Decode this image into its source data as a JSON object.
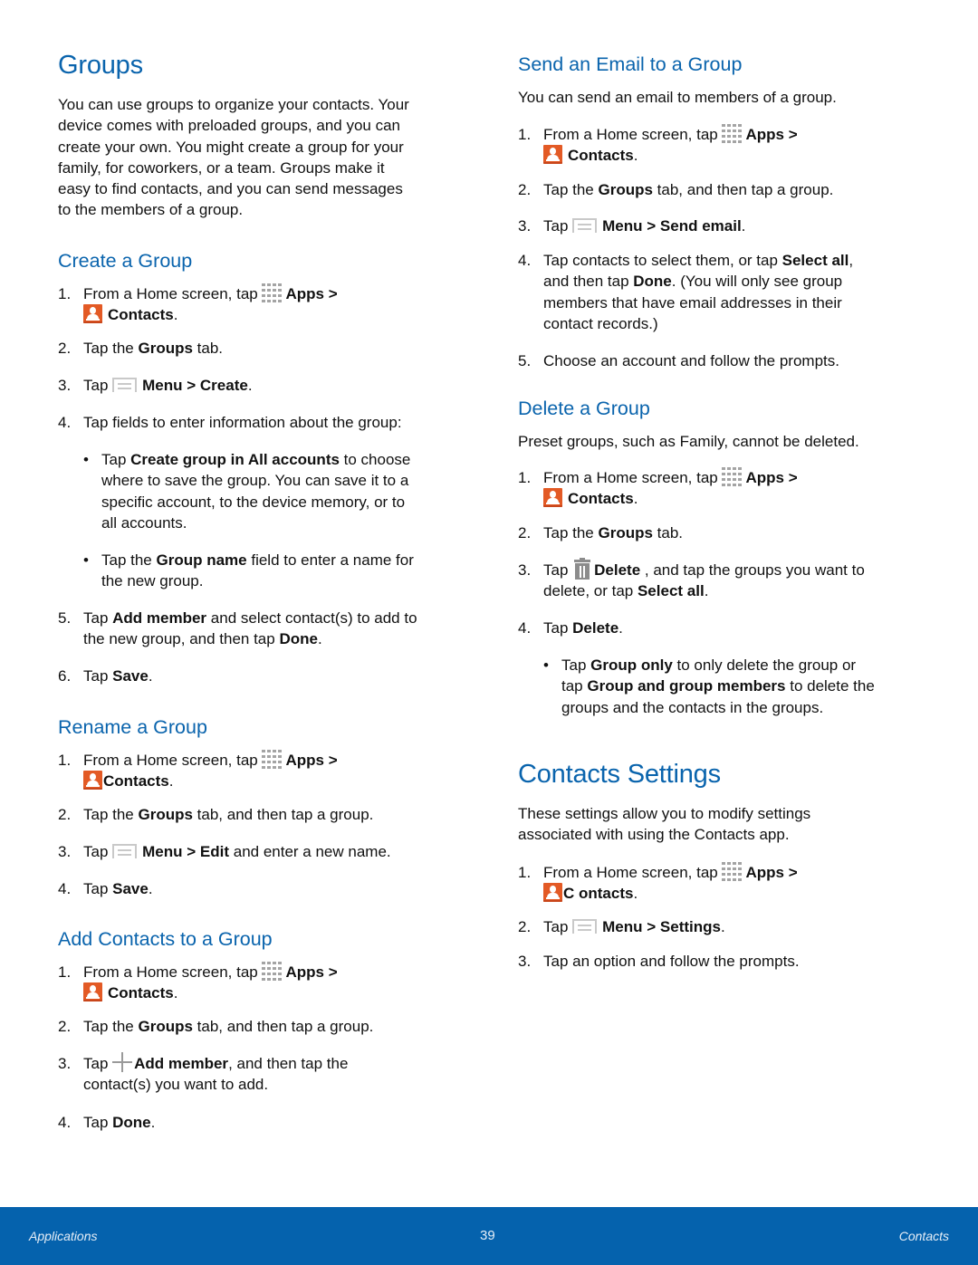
{
  "page": {
    "number": "39",
    "footer_left": "Applications",
    "footer_right": "Contacts",
    "accent_color": "#0a64ad",
    "footer_color": "#0562ad"
  },
  "groups": {
    "title": "Groups",
    "intro_lines": [
      "You can use groups to organize your contacts. Your",
      "device comes with preloaded groups, and you can",
      "create your own. You might create a group for your",
      "family, for coworkers, or a team. Groups make it",
      "easy to find contacts, and you can send messages",
      "to the members of a group."
    ]
  },
  "create_group": {
    "title": "Create a Group",
    "steps": {
      "s1": {
        "num": "1.",
        "pre": "From a Home screen, tap ",
        "apps": "Apps",
        "gt": " >",
        "contacts": "Contacts",
        "end": "."
      },
      "s2": {
        "num": "2.",
        "pre": "Tap the ",
        "b1": "Groups",
        "post": " tab."
      },
      "s3": {
        "num": "3.",
        "pre": "Tap ",
        "b1": "Menu",
        "mid": " > ",
        "b2": "Create",
        "end": "."
      },
      "s4": {
        "num": "4.",
        "text": "Tap fields to enter information about the group:"
      },
      "bullet1": {
        "dot": "•",
        "pre": "Tap ",
        "b1": "Create group in All accounts",
        "post": " to choose",
        "lines": [
          "where to save the group. You can save it to a",
          "specific account, to the device memory, or to",
          "all accounts."
        ]
      },
      "bullet2": {
        "dot": "•",
        "pre": "Tap the ",
        "b1": "Group name",
        "post": " field to enter a name for",
        "line2": "the new group."
      },
      "s5": {
        "num": "5.",
        "pre": "Tap ",
        "b1": "Add member",
        "post": " and select contact(s) to add to",
        "line2_pre": "the new group, and then tap ",
        "line2_b": "Done",
        "line2_end": "."
      },
      "s6": {
        "num": "6.",
        "pre": "Tap ",
        "b1": "Save",
        "end": "."
      }
    }
  },
  "rename_group": {
    "title": "Rename a Group",
    "steps": {
      "s1": {
        "num": "1.",
        "pre": "From a Home screen, tap ",
        "apps": "Apps",
        "gt": " >",
        "contacts": "Contacts",
        "end": "."
      },
      "s2": {
        "num": "2.",
        "pre": "Tap the ",
        "b1": "Groups",
        "post": " tab, and then tap a group."
      },
      "s3": {
        "num": "3.",
        "pre": "Tap ",
        "b1": "Menu",
        "mid": " > ",
        "b2": "Edit",
        "post": " and enter a new name."
      },
      "s4": {
        "num": "4.",
        "pre": "Tap ",
        "b1": "Save",
        "end": "."
      }
    }
  },
  "add_contacts": {
    "title": "Add Contacts to a Group",
    "steps": {
      "s1": {
        "num": "1.",
        "pre": "From a Home screen, tap ",
        "apps": "Apps",
        "gt": " >",
        "contacts": "Contacts",
        "end": "."
      },
      "s2": {
        "num": "2.",
        "pre": "Tap the ",
        "b1": "Groups",
        "post": " tab, and then tap a group."
      },
      "s3": {
        "num": "3.",
        "pre": "Tap ",
        "b1": "Add member",
        "post": ", and then tap the",
        "line2": "contact(s) you want to add."
      },
      "s4": {
        "num": "4.",
        "pre": "Tap ",
        "b1": "Done",
        "end": "."
      }
    }
  },
  "send_email": {
    "title": "Send an Email to a Group",
    "intro": "You can send an email to members of a group.",
    "steps": {
      "s1": {
        "num": "1.",
        "pre": "From a Home screen, tap ",
        "apps": "Apps",
        "gt": " >",
        "contacts": "Contacts",
        "end": "."
      },
      "s2": {
        "num": "2.",
        "pre": "Tap the ",
        "b1": "Groups",
        "post": " tab, and then tap a group."
      },
      "s3": {
        "num": "3.",
        "pre": "Tap ",
        "b1": "Menu",
        "mid": " > ",
        "b2": "Send email",
        "end": "."
      },
      "s4": {
        "num": "4.",
        "pre": "Tap contacts to select them, or tap ",
        "b1": "Select all",
        "end": ",",
        "line2_pre": "and then tap ",
        "line2_b": "Done",
        "line2_post": ". (You will only see group",
        "line3": "members that have email addresses in their",
        "line4": "contact records.)"
      },
      "s5": {
        "num": "5.",
        "text": "Choose an account and follow the prompts."
      }
    }
  },
  "delete_group": {
    "title": "Delete a Group",
    "intro": "Preset groups, such as Family, cannot be deleted.",
    "steps": {
      "s1": {
        "num": "1.",
        "pre": "From a Home screen, tap ",
        "apps": "Apps",
        "gt": " >",
        "contacts": "Contacts",
        "end": "."
      },
      "s2": {
        "num": "2.",
        "pre": "Tap the ",
        "b1": "Groups",
        "post": " tab."
      },
      "s3": {
        "num": "3.",
        "pre": "Tap ",
        "b1": "Delete",
        "post": " , and tap the groups you want to",
        "line2_pre": "delete, or tap ",
        "line2_b": "Select all",
        "line2_end": "."
      },
      "s4": {
        "num": "4.",
        "pre": "Tap ",
        "b1": "Delete",
        "end": "."
      },
      "bullet1": {
        "dot": "•",
        "pre": "Tap ",
        "b1": "Group only",
        "post": " to only delete the group or",
        "line2_pre": "tap ",
        "line2_b": "Group and group members",
        "line2_post": " to delete the",
        "line3": "groups and the contacts in the groups."
      }
    }
  },
  "contacts_settings": {
    "title": "Contacts Settings",
    "intro_lines": [
      "These settings allow you to modify settings",
      "associated with using the Contacts app."
    ],
    "steps": {
      "s1": {
        "num": "1.",
        "pre": "From a Home screen, tap ",
        "apps": "Apps",
        "gt": " >",
        "contacts": "C ontacts",
        "end": "."
      },
      "s2": {
        "num": "2.",
        "pre": "Tap ",
        "b1": "Menu",
        "mid": " > ",
        "b2": "Settings",
        "end": "."
      },
      "s3": {
        "num": "3.",
        "text": "Tap an option and follow the prompts."
      }
    }
  }
}
